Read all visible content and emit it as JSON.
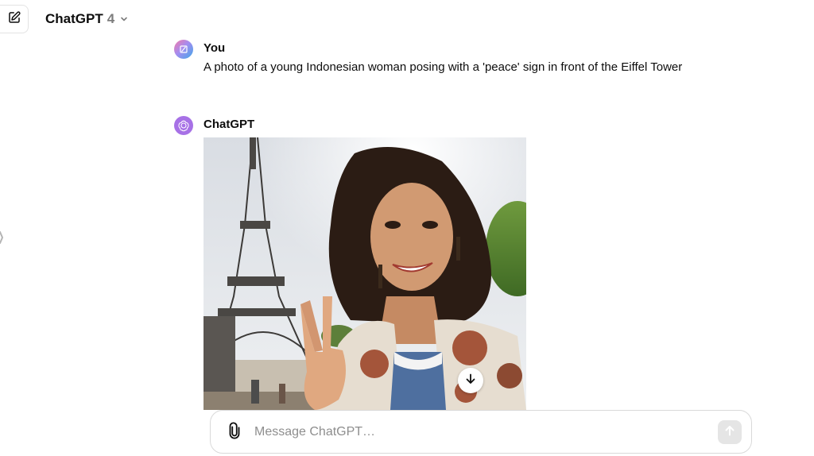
{
  "header": {
    "new_chat_icon": "edit-square-icon",
    "model_name": "ChatGPT",
    "model_version": "4",
    "model_dropdown_icon": "chevron-down-icon"
  },
  "conversation": {
    "user_message": {
      "author": "You",
      "text": "A photo of a young Indonesian woman posing with a 'peace' sign in front of the Eiffel Tower"
    },
    "assistant_message": {
      "author": "ChatGPT",
      "image_icon": "generated-image",
      "download_icon": "arrow-down-icon"
    }
  },
  "composer": {
    "placeholder": "Message ChatGPT…",
    "value": "",
    "attach_icon": "paperclip-icon",
    "send_icon": "arrow-up-icon"
  },
  "colors": {
    "assistant_avatar": "#a771e6",
    "text": "#0d0d0d",
    "send_disabled": "#e5e5e5"
  }
}
